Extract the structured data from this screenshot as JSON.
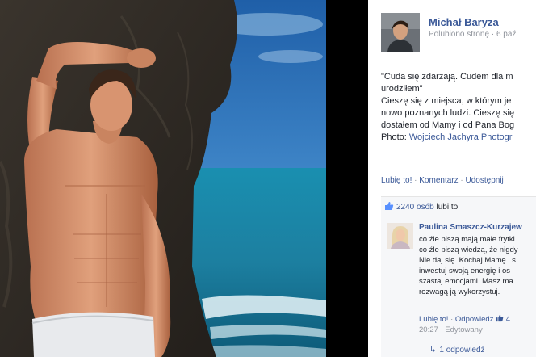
{
  "post": {
    "author": "Michał Baryza",
    "meta": "Polubiono stronę · 6 paź",
    "caption_lines": [
      "\"Cuda się zdarzają. Cudem dla m",
      "urodziłem\""
    ],
    "body_lines": [
      "Cieszę się z miejsca, w którym je",
      "nowo poznanych ludzi. Cieszę się",
      "dostałem od Mamy i od Pana Bog"
    ],
    "photo_prefix": "Photo:",
    "photo_credit": "Wojciech Jachyra Photogr"
  },
  "actions": {
    "like": "Lubię to!",
    "comment": "Komentarz",
    "share": "Udostępnij"
  },
  "likes": {
    "count": "2240 osób",
    "suffix": "lubi to."
  },
  "comment": {
    "author": "Paulina Smaszcz-Kurzajew",
    "lines": [
      "co źle piszą mają małe frytki",
      "co źle piszą wiedzą, że nigdy",
      "Nie daj się. Kochaj Mamę i s",
      "inwestuj swoją energię i os",
      "szastaj emocjami. Masz ma",
      "rozwagą ją wykorzystuj."
    ],
    "like": "Lubię to!",
    "reply": "Odpowiedz",
    "like_count": "4",
    "time": "20:27",
    "edited": "Edytowany"
  },
  "replies": {
    "label": "1 odpowiedź"
  },
  "colors": {
    "link": "#3b5998",
    "text": "#1d2129",
    "muted": "#90949c"
  }
}
